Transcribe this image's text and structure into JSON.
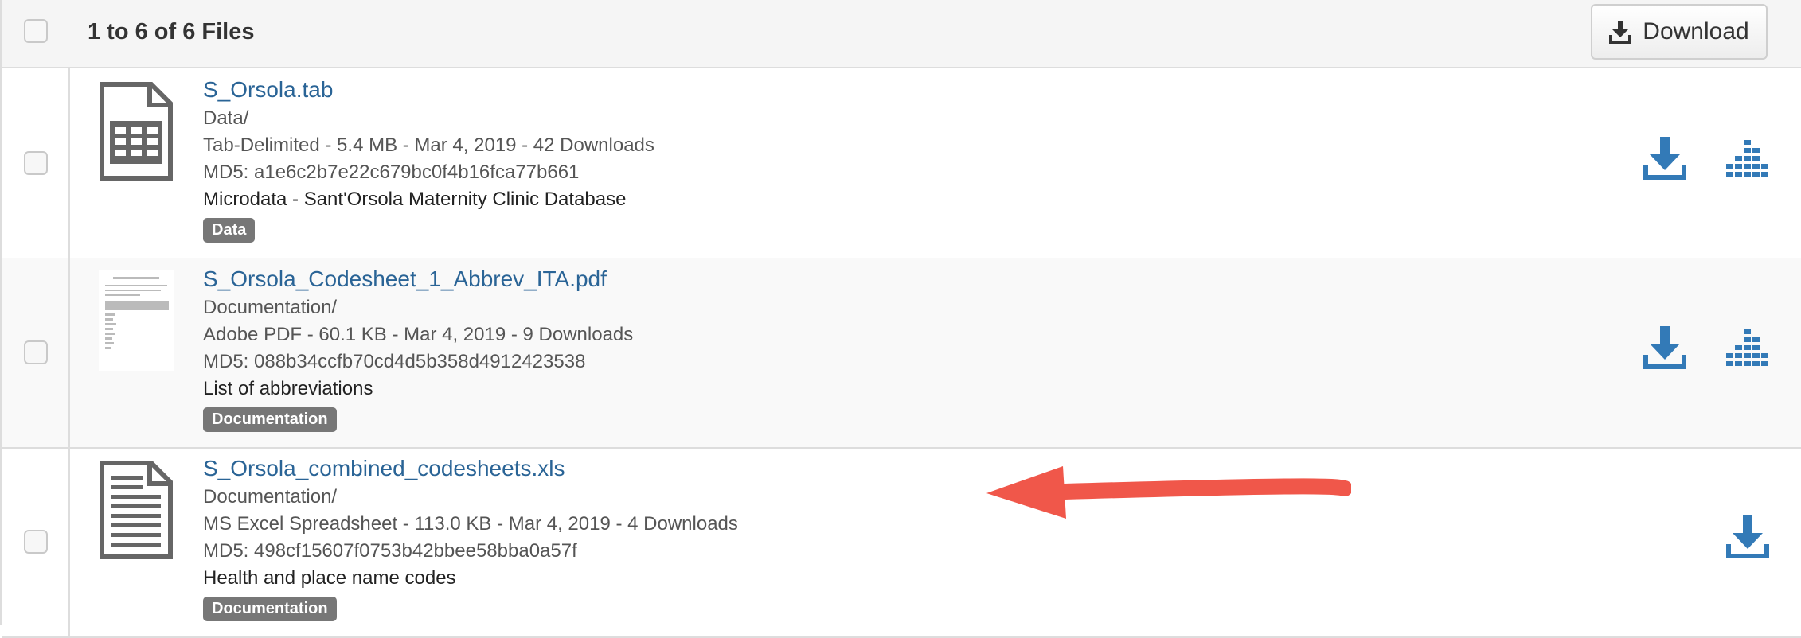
{
  "header": {
    "count_label": "1 to 6 of 6 Files",
    "download_label": "Download"
  },
  "files": [
    {
      "name": "S_Orsola.tab",
      "folder": "Data/",
      "meta": "Tab-Delimited - 5.4 MB - Mar 4, 2019 - 42 Downloads",
      "md5": "MD5: a1e6c2b7e22c679bc0f4b16fca77b661",
      "description": "Microdata - Sant'Orsola Maternity Clinic Database",
      "tag": "Data",
      "icon": "tabular-file-icon"
    },
    {
      "name": "S_Orsola_Codesheet_1_Abbrev_ITA.pdf",
      "folder": "Documentation/",
      "meta": "Adobe PDF - 60.1 KB - Mar 4, 2019 - 9 Downloads",
      "md5": "MD5: 088b34ccfb70cd4d5b358d4912423538",
      "description": "List of abbreviations",
      "tag": "Documentation",
      "icon": "pdf-thumbnail"
    },
    {
      "name": "S_Orsola_combined_codesheets.xls",
      "folder": "Documentation/",
      "meta": "MS Excel Spreadsheet - 113.0 KB - Mar 4, 2019 - 4 Downloads",
      "md5": "MD5: 498cf15607f0753b42bbee58bba0a57f",
      "description": "Health and place name codes",
      "tag": "Documentation",
      "icon": "document-file-icon"
    }
  ],
  "colors": {
    "link": "#2a6496",
    "action": "#337ab7",
    "badge": "#777777",
    "annotation_arrow": "#f0574a"
  }
}
